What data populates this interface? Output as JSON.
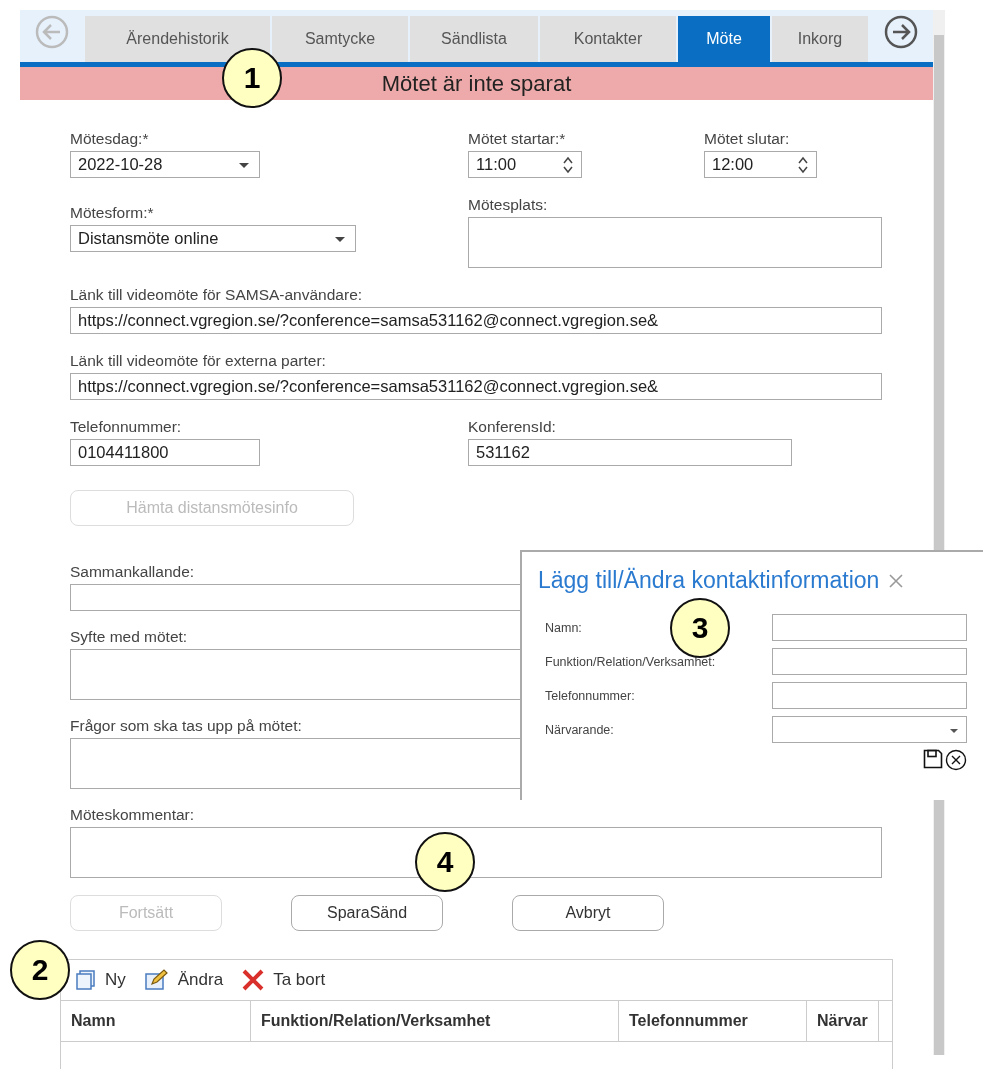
{
  "nav_buttons": [
    {
      "kind": "back",
      "disabled": true
    },
    {
      "kind": "forward",
      "disabled": false
    }
  ],
  "tabs": [
    {
      "label": "Ärendehistorik",
      "selected": false
    },
    {
      "label": "Samtycke",
      "selected": false
    },
    {
      "label": "Sändlista",
      "selected": false
    },
    {
      "label": "Kontakter",
      "selected": false
    },
    {
      "label": "Möte",
      "selected": true
    },
    {
      "label": "Inkorg",
      "selected": false
    }
  ],
  "status_banner": "Mötet är inte sparat",
  "form_rows": [
    [
      {
        "label": "Mötesdag:*",
        "kind": "select",
        "value": "2022-10-28"
      },
      {
        "label": "Mötet startar:*",
        "kind": "spinner",
        "value": "11:00"
      },
      {
        "label": "Mötet slutar:",
        "kind": "spinner",
        "value": "12:00"
      }
    ],
    [
      {
        "label": "Mötesform:*",
        "kind": "select",
        "value": "Distansmöte online"
      },
      {
        "label": "Mötesplats:",
        "kind": "textarea"
      }
    ],
    [
      {
        "label": "Länk till videomöte för SAMSA-användare:",
        "kind": "text",
        "value": "https://connect.vgregion.se/?conference=samsa531162@connect.vgregion.se&"
      }
    ],
    [
      {
        "label": "Länk till videomöte för externa parter:",
        "kind": "text",
        "value": "https://connect.vgregion.se/?conference=samsa531162@connect.vgregion.se&"
      }
    ],
    [
      {
        "label": "Telefonnummer:",
        "kind": "text",
        "value": "0104411800"
      },
      {
        "label": "KonferensId:",
        "kind": "text",
        "value": "531162"
      }
    ]
  ],
  "fetch_button": {
    "label": "Hämta distansmötesinfo",
    "disabled": true
  },
  "lower_fields": [
    {
      "label": "Sammankallande:",
      "kind": "text"
    },
    {
      "label": "Syfte med mötet:",
      "kind": "textarea"
    },
    {
      "label": "Frågor som ska tas upp på mötet:",
      "kind": "textarea"
    },
    {
      "label": "Möteskommentar:",
      "kind": "textarea"
    }
  ],
  "action_buttons": [
    {
      "label": "Fortsätt",
      "disabled": true
    },
    {
      "label": "SparaSänd",
      "disabled": false
    },
    {
      "label": "Avbryt",
      "disabled": false
    }
  ],
  "contacts": {
    "toolbar": [
      {
        "kind": "new",
        "label": "Ny"
      },
      {
        "kind": "edit",
        "label": "Ändra"
      },
      {
        "kind": "delete",
        "label": "Ta bort"
      }
    ],
    "columns": [
      "Namn",
      "Funktion/Relation/Verksamhet",
      "Telefonnummer",
      "Närvar"
    ]
  },
  "dialog": {
    "title": "Lägg till/Ändra kontaktinformation",
    "fields": [
      {
        "label": "Namn:",
        "kind": "text"
      },
      {
        "label": "Funktion/Relation/Verksamhet:",
        "kind": "text"
      },
      {
        "label": "Telefonnummer:",
        "kind": "text"
      },
      {
        "label": "Närvarande:",
        "kind": "select"
      }
    ]
  },
  "callouts": [
    "1",
    "2",
    "3",
    "4"
  ]
}
